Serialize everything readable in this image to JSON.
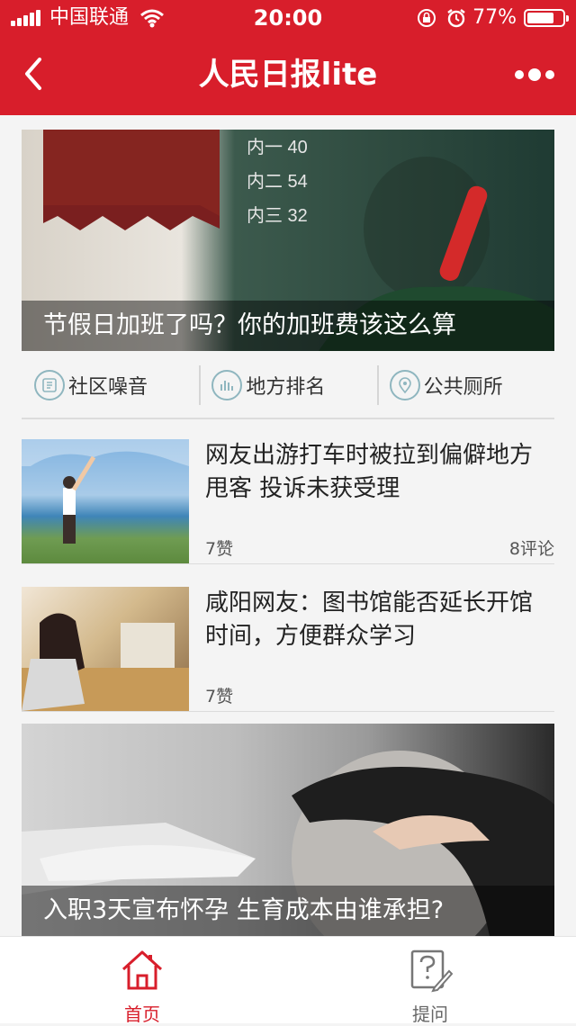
{
  "status_bar": {
    "carrier": "中国联通",
    "time": "20:00",
    "battery_percent": "77%",
    "battery_level": 0.77
  },
  "nav": {
    "title": "人民日报lite"
  },
  "banner_top": {
    "caption": "节假日加班了吗？你的加班费该这么算"
  },
  "quick_links": [
    {
      "label": "社区噪音",
      "icon": "noise-icon"
    },
    {
      "label": "地方排名",
      "icon": "ranking-chart-icon"
    },
    {
      "label": "公共厕所",
      "icon": "location-pin-icon"
    }
  ],
  "news": [
    {
      "title": "网友出游打车时被拉到偏僻地方甩客 投诉未获受理",
      "likes": "7赞",
      "comments": "8评论"
    },
    {
      "title": "咸阳网友：图书馆能否延长开馆时间，方便群众学习",
      "likes": "7赞"
    }
  ],
  "banner_bottom": {
    "caption": "入职3天宣布怀孕 生育成本由谁承担?"
  },
  "tabbar": {
    "home_label": "首页",
    "ask_label": "提问"
  },
  "colors": {
    "brand_red": "#d81e2b",
    "icon_teal": "#8fb6bf"
  }
}
